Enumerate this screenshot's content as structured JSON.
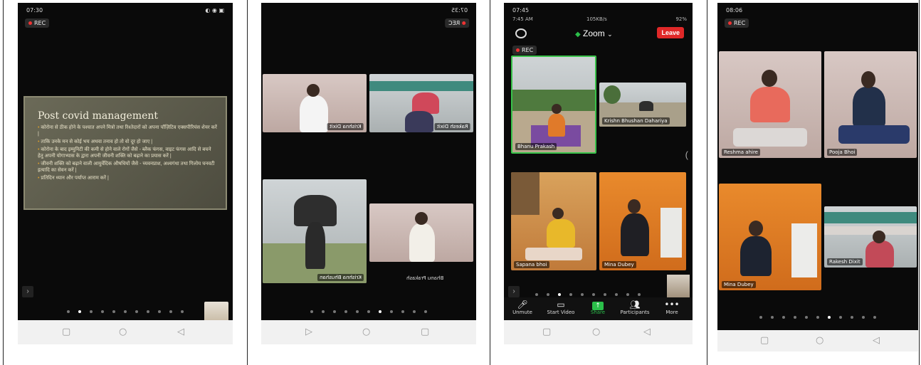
{
  "panels": [
    {
      "status_time": "07:30",
      "status_icons": "◐ ◉ ▣",
      "rec_label": "REC",
      "slide": {
        "title": "Post covid management",
        "bullets": [
          "कोरोना से ठीक होने के पश्चात अपने मित्रो तथा रिश्तेदारों को अपना पॉज़िटिव एक्सपीरियंस शेयर करें |",
          "ताकि उनके मन से कोई भय अथवा तनाव हो तो वो दूर हो जाए |",
          "कोरोना के बाद इम्युनिटी की कमी से होने वाले रोगों जैसे - ब्लैक फंगस, वाइट फंगस आदि से बचने हेतु अपनी योगाभ्यास के द्वारा अपनी जीवनी शक्ति को बढ़ाने का प्रयास करें |",
          "जीवनी शक्ति को बढ़ाने वाली आयुर्वेदिक औषधियों जैसे - च्यवनप्राश, अश्वगंधा तथा गिलोय घनवटी इत्यादि का सेवन करें |",
          "प्रतिदिन ध्यान और पर्याप्त आराम करें |"
        ]
      }
    },
    {
      "status_time": "07:35",
      "rec_label": "REC",
      "tiles": [
        "Krishna Dixit",
        "Rakesh Dixit",
        "Krishna Bhushan",
        "Bhanu Prakash"
      ]
    },
    {
      "status_time": "07:45",
      "status_sub": "7:45 AM",
      "status_net": "105KB/s",
      "status_battery": "92%",
      "meeting_title": "Zoom",
      "leave_label": "Leave",
      "rec_label": "REC",
      "tiles": [
        "Bhanu Prakash",
        "Krishn Bhushan Dahariya",
        "Sapana bhoi",
        "Mina Dubey"
      ],
      "toolbar": [
        {
          "label": "Unmute",
          "icon": "mic-off-icon"
        },
        {
          "label": "Start Video",
          "icon": "video-off-icon"
        },
        {
          "label": "Share",
          "icon": "share-icon"
        },
        {
          "label": "Participants",
          "icon": "participants-icon"
        },
        {
          "label": "More",
          "icon": "more-icon"
        }
      ]
    },
    {
      "status_time": "08:06",
      "rec_label": "REC",
      "tiles": [
        "Reshma ahire",
        "Pooja Bhoi",
        "Mina Dubey",
        "Rakesh Dixit"
      ]
    }
  ],
  "colors": {
    "share": "#2bbf4a",
    "leave": "#e02828",
    "rec_dot": "#e33333"
  }
}
